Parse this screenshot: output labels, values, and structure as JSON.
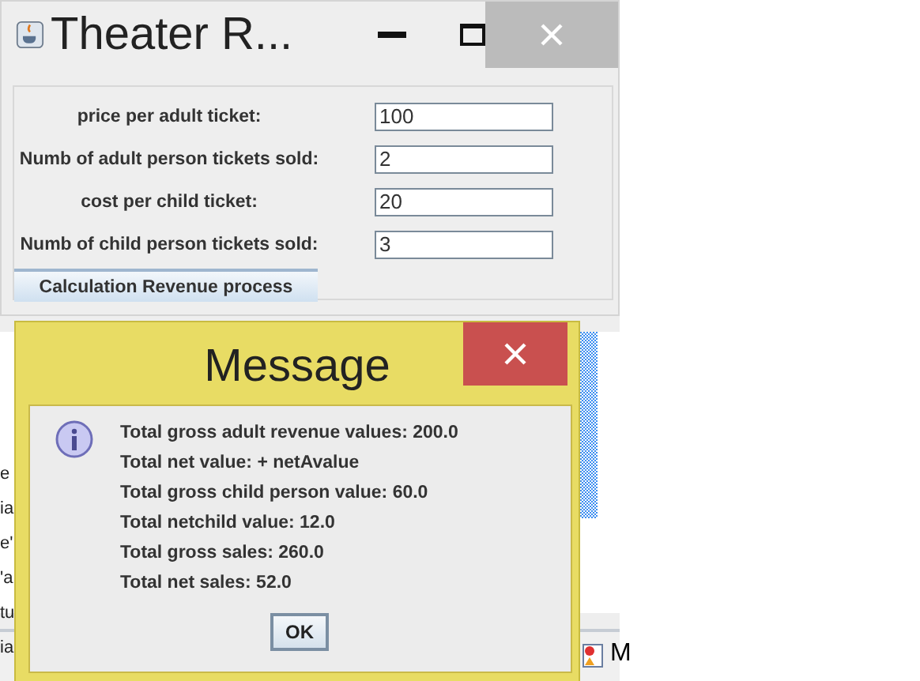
{
  "background_window": {
    "line_fragments": [
      "e",
      "ia",
      "e'",
      "'a",
      "tu",
      "ia"
    ],
    "taskbar_label": "M"
  },
  "window": {
    "title": "Theater R...",
    "fields": [
      {
        "label": "price per adult ticket:",
        "value": "100"
      },
      {
        "label": "Numb of adult person tickets sold:",
        "value": "2"
      },
      {
        "label": "cost per child ticket:",
        "value": "20"
      },
      {
        "label": "Numb of child person tickets sold:",
        "value": "3"
      }
    ],
    "button": "Calculation Revenue process"
  },
  "dialog": {
    "title": "Message",
    "lines": [
      "Total gross adult revenue values: 200.0",
      "Total net value: + netAvalue",
      "Total gross child person value: 60.0",
      "Total netchild value: 12.0",
      "Total gross sales: 260.0",
      "Total net sales: 52.0"
    ],
    "button": "OK"
  }
}
